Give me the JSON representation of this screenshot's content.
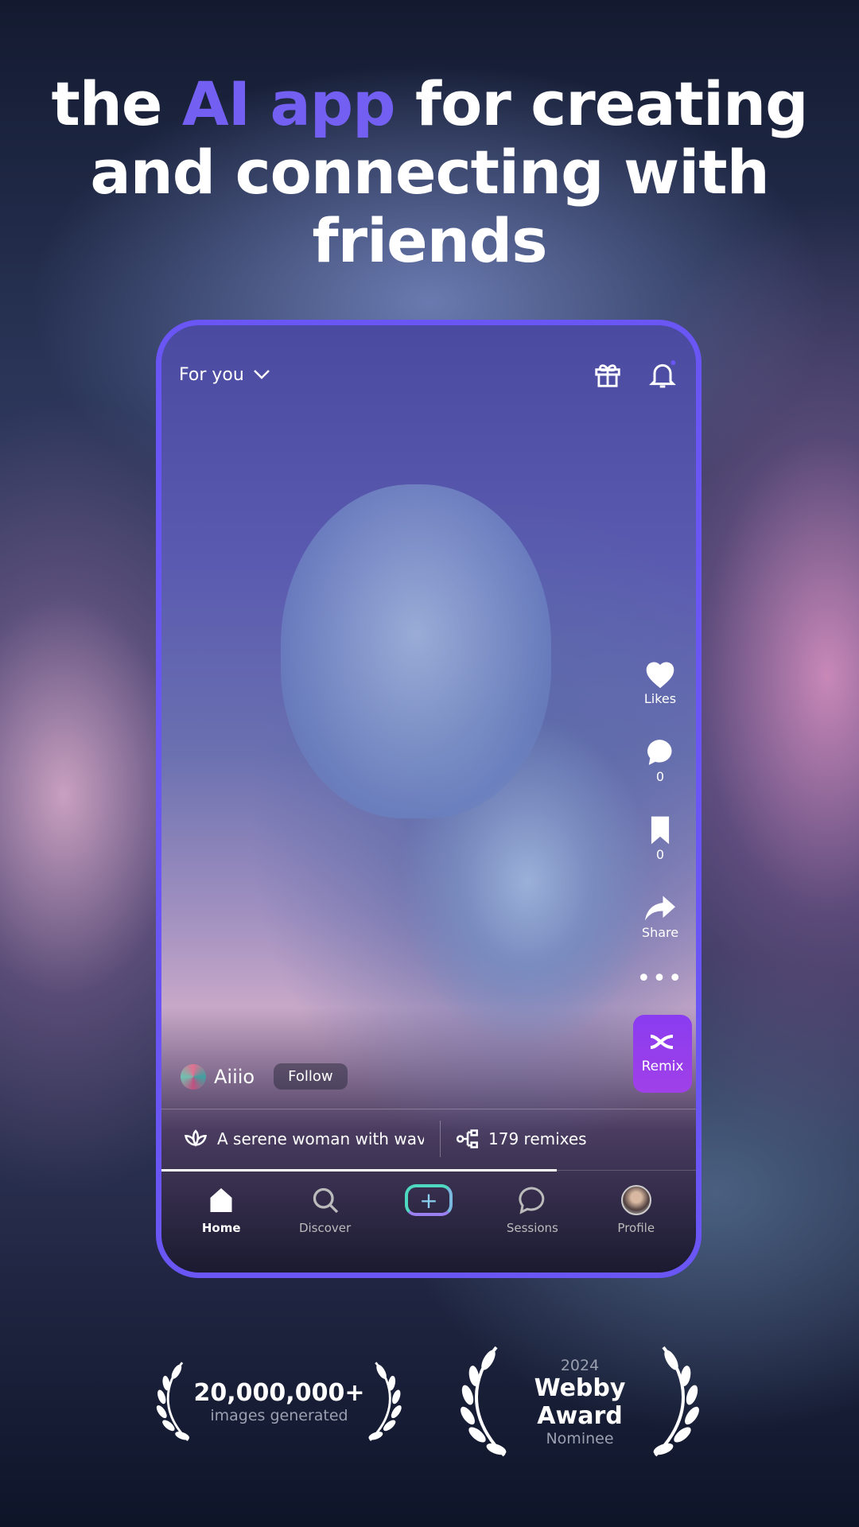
{
  "headline": {
    "pre": "the ",
    "accent": "AI app",
    "post": " for creating and connecting with friends",
    "accent_color": "#7360f2"
  },
  "phone": {
    "feed_selector": "For you",
    "top_icons": [
      "gift-icon",
      "bell-icon"
    ],
    "actions": {
      "likes": "Likes",
      "comments": "0",
      "saves": "0",
      "share": "Share",
      "remix": "Remix"
    },
    "author": {
      "name": "Aiiio",
      "follow": "Follow"
    },
    "prompt": "A serene woman with wav",
    "remixes": "179 remixes",
    "progress": 0.74,
    "nav": [
      {
        "label": "Home",
        "active": true
      },
      {
        "label": "Discover"
      },
      {
        "label": "Create"
      },
      {
        "label": "Sessions"
      },
      {
        "label": "Profile"
      }
    ]
  },
  "awards": [
    {
      "value": "20,000,000+",
      "caption": "images generated"
    },
    {
      "year": "2024",
      "value": "Webby Award",
      "caption": "Nominee"
    }
  ]
}
